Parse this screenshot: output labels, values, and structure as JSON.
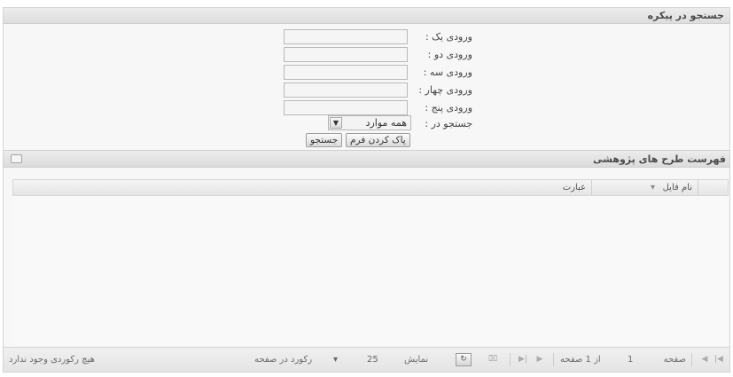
{
  "search_panel": {
    "title": "جستجو در پیکره",
    "fields": [
      {
        "label": "ورودی یک :",
        "value": ""
      },
      {
        "label": "ورودی دو :",
        "value": ""
      },
      {
        "label": "ورودی سه :",
        "value": ""
      },
      {
        "label": "ورودی چهار :",
        "value": ""
      },
      {
        "label": "ورودی پنج :",
        "value": ""
      }
    ],
    "scope_label": "جستجو در :",
    "scope_value": "همه موارد",
    "clear_button": "پاک کردن فرم",
    "search_button": "جستجو"
  },
  "grid": {
    "title": "فهرست طرح های پژوهشی",
    "columns": [
      "نام فایل",
      "عبارت"
    ],
    "sort_indicator": "▾",
    "paging": {
      "page_label": "صفحه",
      "page_value": "1",
      "of_pages": "از 1 صفحه",
      "show_label": "نمایش",
      "page_size": "25",
      "per_page_label": "رکورد در صفحه",
      "empty_message": "هیچ رکوردی وجود ندارد"
    }
  },
  "icons": {
    "dropdown": "chevron-down-icon",
    "collapse": "collapse-icon",
    "refresh": "refresh-icon"
  }
}
